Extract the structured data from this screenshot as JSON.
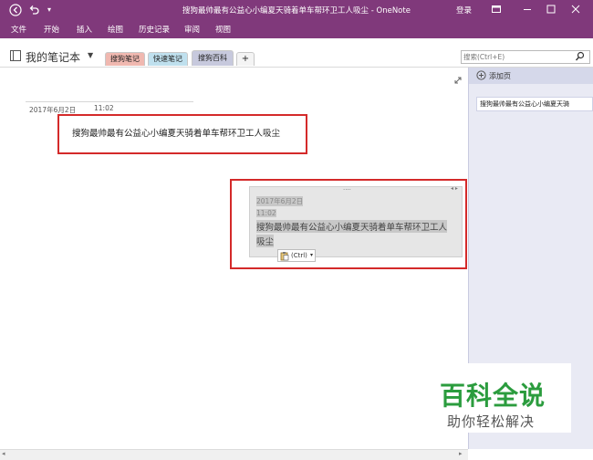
{
  "window": {
    "title": "搜狗最帅最有公益心小编夏天骑着单车帮环卫工人吸尘 - OneNote",
    "login_label": "登录"
  },
  "ribbon": {
    "tabs": [
      "文件",
      "开始",
      "插入",
      "绘图",
      "历史记录",
      "审阅",
      "视图"
    ]
  },
  "notebook": {
    "name": "我的笔记本",
    "sections": [
      "搜狗笔记",
      "快速笔记",
      "搜狗百科"
    ],
    "add_section": "+"
  },
  "search": {
    "placeholder": "搜索(Ctrl+E)"
  },
  "page": {
    "date": "2017年6月2日",
    "time": "11:02",
    "note_text": "搜狗最帅最有公益心小编夏天骑着单车帮环卫工人吸尘"
  },
  "pasted": {
    "date": "2017年6月2日",
    "time": "11:02",
    "line1": "搜狗最帅最有公益心小编夏天骑着单车帮环卫工人",
    "line2": "吸尘",
    "paste_option": "(Ctrl)",
    "dots": "....",
    "arrows": "◂ ▸"
  },
  "pages_pane": {
    "add_page": "添加页",
    "items": [
      "搜狗最帅最有公益心小编夏天骑"
    ]
  },
  "watermark": {
    "line1": "百科全说",
    "line2": "助你轻松解决"
  },
  "colors": {
    "titlebar": "#80397b",
    "highlight_red": "#d42a2a",
    "section_tabs": [
      "#f0b8b0",
      "#bfe0ee",
      "#c7c9dd"
    ],
    "watermark_green": "#2b9c3e"
  }
}
